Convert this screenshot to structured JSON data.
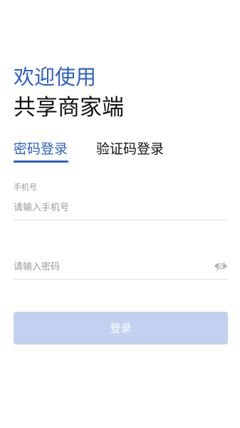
{
  "header": {
    "welcome": "欢迎使用",
    "subtitle": "共享商家端"
  },
  "tabs": [
    {
      "label": "密码登录",
      "active": true
    },
    {
      "label": "验证码登录",
      "active": false
    }
  ],
  "phone": {
    "label": "手机号",
    "placeholder": "请输入手机号",
    "value": ""
  },
  "password": {
    "placeholder": "请输入密码",
    "value": "",
    "toggle_icon": "eye-off-icon"
  },
  "login_button": {
    "label": "登录",
    "state": "disabled"
  },
  "colors": {
    "accent": "#2d5fc4",
    "button_disabled": "#c2d1ef",
    "placeholder": "#9a9a9a",
    "divider": "#dcdcdc"
  }
}
